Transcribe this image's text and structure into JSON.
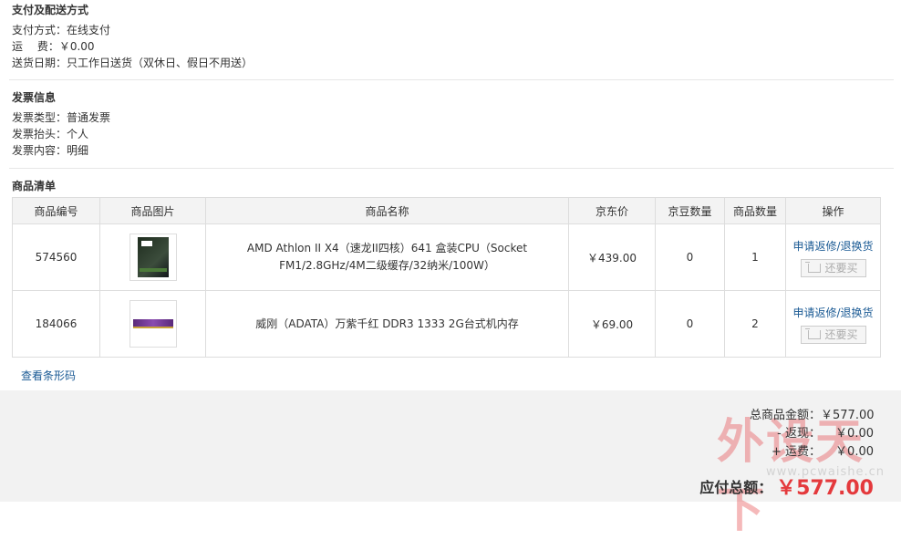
{
  "payment": {
    "title": "支付及配送方式",
    "method": "支付方式：在线支付",
    "fee": "运　 费：￥0.00",
    "date": "送货日期：只工作日送货（双休日、假日不用送）"
  },
  "invoice": {
    "title": "发票信息",
    "type": "发票类型：普通发票",
    "header": "发票抬头：个人",
    "content": "发票内容：明细"
  },
  "goods": {
    "title": "商品清单",
    "headers": [
      "商品编号",
      "商品图片",
      "商品名称",
      "京东价",
      "京豆数量",
      "商品数量",
      "操作"
    ],
    "rows": [
      {
        "id": "574560",
        "image_icon": "cpu-box-image",
        "name": "AMD Athlon II X4（速龙II四核）641 盒装CPU（Socket FM1/2.8GHz/4M二级缓存/32纳米/100W）",
        "price": "￥439.00",
        "beans": "0",
        "qty": "1",
        "op_link": "申请返修/退换货",
        "op_button": "还要买"
      },
      {
        "id": "184066",
        "image_icon": "ram-stick-image",
        "name": "威刚（ADATA）万紫千红 DDR3 1333 2G台式机内存",
        "price": "￥69.00",
        "beans": "0",
        "qty": "2",
        "op_link": "申请返修/退换货",
        "op_button": "还要买"
      }
    ],
    "barcode_link": "查看条形码"
  },
  "summary": {
    "goods_total_label": "总商品金额：",
    "goods_total": "￥577.00",
    "cashback_label": "- 返现：",
    "cashback": "￥0.00",
    "shipping_label": "+ 运费：",
    "shipping": "￥0.00",
    "pay_total_label": "应付总额：",
    "pay_total": "￥577.00"
  },
  "watermark": {
    "text": "外设天下",
    "url": "www.pcwaishe.cn"
  },
  "colors": {
    "price_red": "#e4393c",
    "link_blue": "#1a5a94"
  }
}
